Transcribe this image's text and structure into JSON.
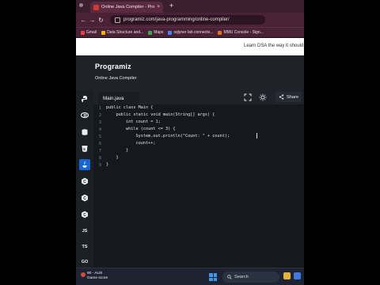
{
  "browser": {
    "tab_title": "Online Java Compiler - Progra...",
    "new_tab": "+",
    "url": "programiz.com/java-programming/online-compiler/",
    "bookmarks": [
      {
        "label": "Gmail",
        "color": "#ea4335"
      },
      {
        "label": "Data Structure and...",
        "color": "#f4b400"
      },
      {
        "label": "Maps",
        "color": "#34a853"
      },
      {
        "label": "sqlyner lab connecte...",
        "color": "#4285f4"
      },
      {
        "label": "MMU Console - Sign...",
        "color": "#e76f24"
      }
    ]
  },
  "banner": {
    "text": "Learn DSA the way it should"
  },
  "site": {
    "logo": "Programiz",
    "subtitle": "Online Java Compiler"
  },
  "sidebar": {
    "items": [
      {
        "name": "python",
        "label": ""
      },
      {
        "name": "r",
        "label": ""
      },
      {
        "name": "sql",
        "label": ""
      },
      {
        "name": "html",
        "label": ""
      },
      {
        "name": "java",
        "label": ""
      },
      {
        "name": "c",
        "label": ""
      },
      {
        "name": "cpp",
        "label": ""
      },
      {
        "name": "csharp",
        "label": ""
      },
      {
        "name": "js",
        "label": "JS"
      },
      {
        "name": "ts",
        "label": "TS"
      },
      {
        "name": "go",
        "label": "GO"
      }
    ]
  },
  "editor": {
    "file_tab": "Main.java",
    "share_label": "Share",
    "line_numbers": [
      "1",
      "2",
      "3",
      "4",
      "5",
      "6",
      "7",
      "8",
      "9"
    ],
    "code": [
      "public class Main {",
      "    public static void main(String[] args) {",
      "        int count = 1;",
      "        while (count <= 3) {",
      "            System.out.println(\"Count: \" + count);",
      "            count++;",
      "        }",
      "    }",
      "}"
    ]
  },
  "taskbar": {
    "weather_line1": "90 - AUS",
    "weather_line2": "Game score",
    "search_label": "Search"
  },
  "colors": {
    "active_lang": "#1467d4",
    "header_bg": "#1f2329",
    "editor_bg": "#15181d"
  }
}
